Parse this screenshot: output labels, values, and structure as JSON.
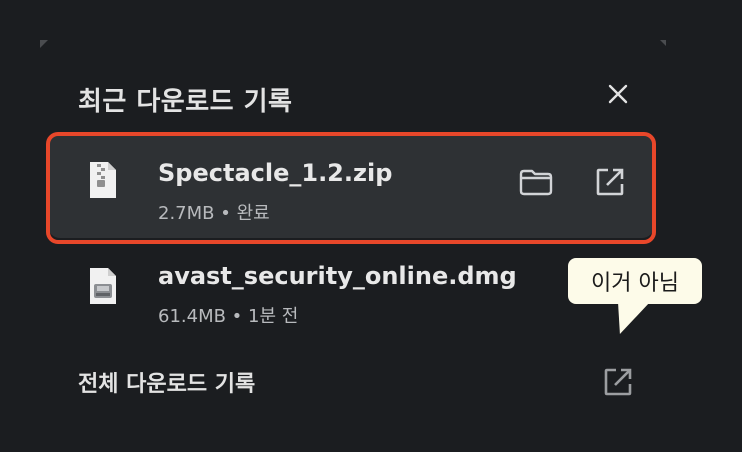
{
  "panel": {
    "title": "최근 다운로드 기록",
    "close_icon": "close-icon"
  },
  "downloads": [
    {
      "filename": "Spectacle_1.2.zip",
      "meta": "2.7MB • 완료",
      "file_icon": "zip-file-icon",
      "actions": [
        "folder-icon",
        "open-external-icon"
      ],
      "highlighted": true
    },
    {
      "filename": "avast_security_online.dmg",
      "meta": "61.4MB • 1분 전",
      "file_icon": "dmg-file-icon"
    }
  ],
  "footer": {
    "label": "전체 다운로드 기록",
    "icon": "open-external-icon"
  },
  "annotation": {
    "text": "이거 아님",
    "highlight_color": "#e8472a",
    "callout_color": "#fdfbe9"
  },
  "colors": {
    "background": "#1b1d20",
    "active_row": "#2e3134",
    "text": "#e3e3e3",
    "secondary_text": "#b8babd"
  }
}
